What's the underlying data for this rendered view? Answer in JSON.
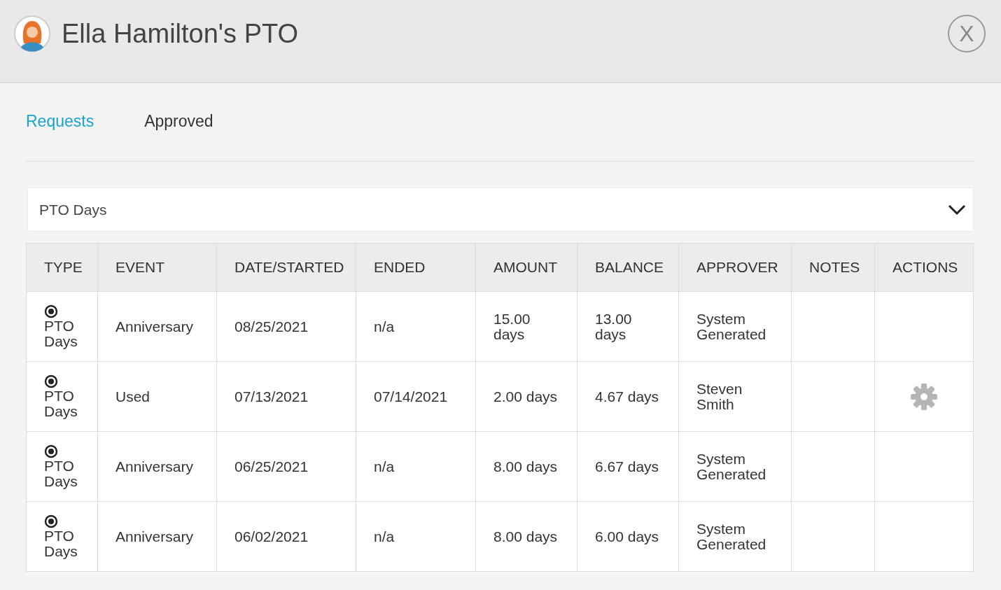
{
  "window": {
    "title": "Ella Hamilton's PTO",
    "close_label": "X"
  },
  "tabs": [
    {
      "label": "Requests",
      "selected": true
    },
    {
      "label": "Approved",
      "selected": false
    }
  ],
  "dropdown": {
    "value": "PTO Days"
  },
  "table": {
    "columns": [
      "TYPE",
      "EVENT",
      "DATE/STARTED",
      "ENDED",
      "AMOUNT",
      "BALANCE",
      "APPROVER",
      "NOTES",
      "ACTIONS"
    ],
    "rows": [
      {
        "type": "PTO Days",
        "event": "Anniversary",
        "date_started": "08/25/2021",
        "ended": "n/a",
        "amount": "15.00 days",
        "balance": "13.00 days",
        "approver": "System Generated",
        "has_settings": false
      },
      {
        "type": "PTO Days",
        "event": "Used",
        "date_started": "07/13/2021",
        "ended": "07/14/2021",
        "amount": "2.00 days",
        "balance": "4.67 days",
        "approver": "Steven Smith",
        "has_settings": true
      },
      {
        "type": "PTO Days",
        "event": "Anniversary",
        "date_started": "06/25/2021",
        "ended": "n/a",
        "amount": "8.00 days",
        "balance": "6.67 days",
        "approver": "System Generated",
        "has_settings": false
      },
      {
        "type": "PTO Days",
        "event": "Anniversary",
        "date_started": "06/02/2021",
        "ended": "n/a",
        "amount": "8.00 days",
        "balance": "6.00 days",
        "approver": "System Generated",
        "has_settings": false
      }
    ]
  }
}
